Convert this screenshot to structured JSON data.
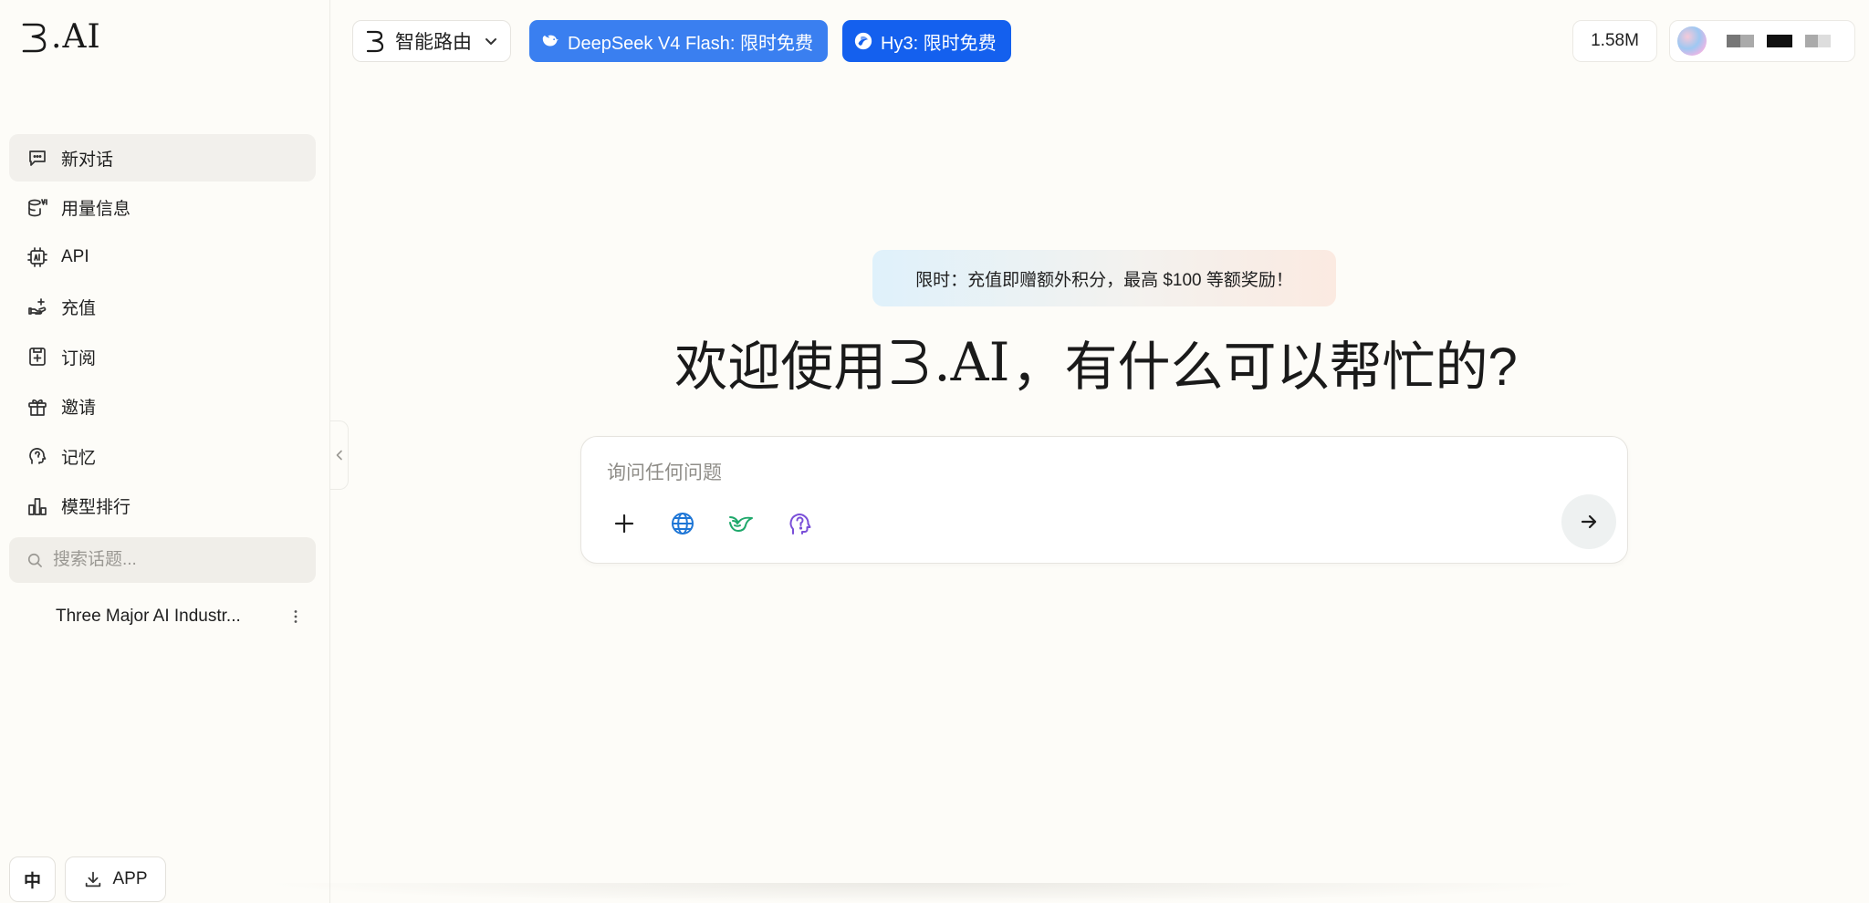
{
  "brand": {
    "logo_text": ".AI"
  },
  "sidebar": {
    "items": [
      {
        "label": "新对话",
        "icon": "chat-bubble-icon",
        "active": true
      },
      {
        "label": "用量信息",
        "icon": "database-ai-icon"
      },
      {
        "label": "API",
        "icon": "chip-icon"
      },
      {
        "label": "充值",
        "icon": "hand-coin-icon"
      },
      {
        "label": "订阅",
        "icon": "subscribe-icon"
      },
      {
        "label": "邀请",
        "icon": "gift-icon"
      },
      {
        "label": "记忆",
        "icon": "brain-head-icon"
      },
      {
        "label": "模型排行",
        "icon": "ranking-chart-icon"
      }
    ],
    "search_placeholder": "搜索话题...",
    "history": [
      {
        "title": "Three Major AI Industr..."
      }
    ],
    "lang_label": "中",
    "app_label": "APP"
  },
  "topbar": {
    "router_label": "智能路由",
    "promo_deepseek": "DeepSeek V4 Flash: 限时免费",
    "promo_hy3": "Hy3: 限时免费",
    "credits": "1.58M"
  },
  "main": {
    "banner": "限时：充值即赠额外积分，最高 $100 等额奖励！",
    "welcome_prefix": "欢迎使用",
    "welcome_brand": ".AI",
    "welcome_suffix": "，有什么可以帮忙的?",
    "input_placeholder": "询问任何问题"
  },
  "colors": {
    "background": "#fdfcf8",
    "promo_deepseek": "#3a7ff0",
    "promo_hy3": "#1460ee",
    "globe_icon": "#1e76d6",
    "wing_icon": "#1fa86b",
    "brain_icon": "#7a4fd8"
  }
}
